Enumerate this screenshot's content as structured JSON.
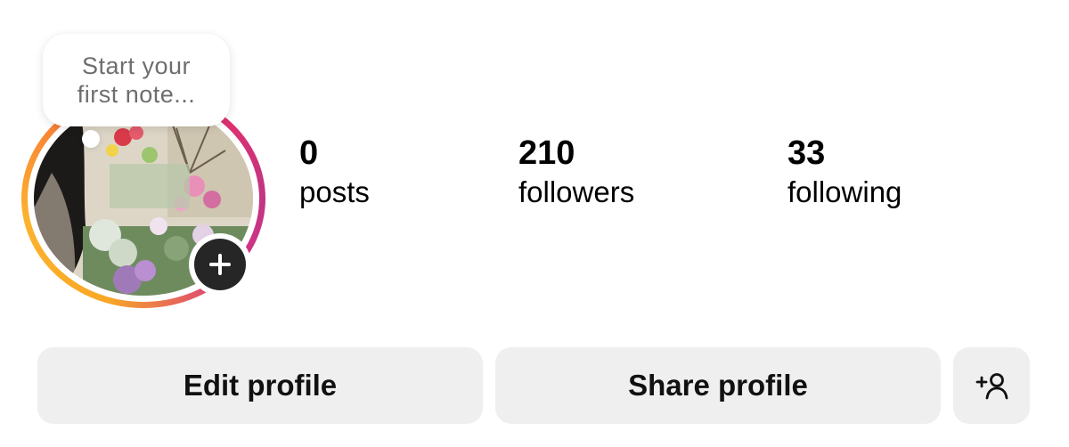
{
  "note": {
    "text_line1": "Start your",
    "text_line2": "first note..."
  },
  "stats": {
    "posts": {
      "count": "0",
      "label": "posts"
    },
    "followers": {
      "count": "210",
      "label": "followers"
    },
    "following": {
      "count": "33",
      "label": "following"
    }
  },
  "actions": {
    "edit_label": "Edit profile",
    "share_label": "Share profile",
    "add_person_icon": "add-person-icon"
  },
  "avatar": {
    "ring_colors": [
      "#f9a825",
      "#f77737",
      "#e1306c",
      "#c13584"
    ],
    "badge_icon": "plus-icon"
  }
}
